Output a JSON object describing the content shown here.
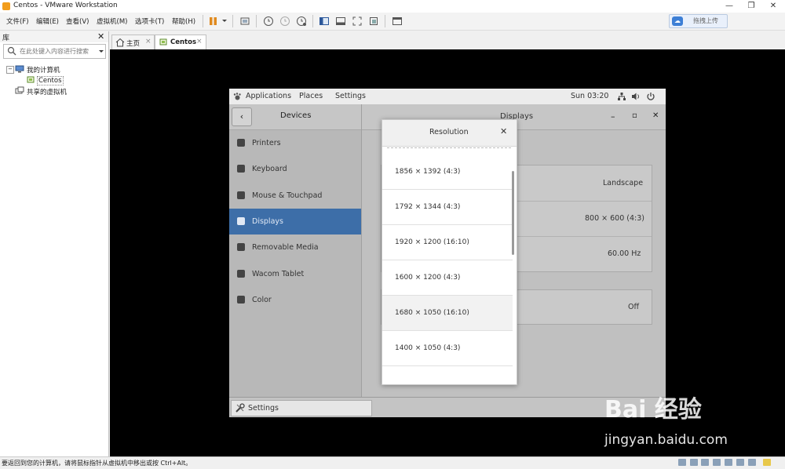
{
  "window": {
    "title": "Centos - VMware Workstation",
    "minimize": "—",
    "restore": "❐",
    "close": "✕"
  },
  "menubar": {
    "items": [
      "文件(F)",
      "编辑(E)",
      "查看(V)",
      "虚拟机(M)",
      "选项卡(T)",
      "帮助(H)"
    ],
    "cloud_button": "拖拽上传"
  },
  "library": {
    "title": "库",
    "close": "✕",
    "search_placeholder": "在此处键入内容进行搜索",
    "tree": {
      "root": "我的计算机",
      "vm": "Centos",
      "shared": "共享的虚拟机"
    }
  },
  "tabs": [
    {
      "label": "主页",
      "close": "×"
    },
    {
      "label": "Centos",
      "close": "×"
    }
  ],
  "gnome": {
    "applications": "Applications",
    "places": "Places",
    "settings": "Settings",
    "clock": "Sun 03:20"
  },
  "settings_window": {
    "sidebar_title": "Devices",
    "back": "‹",
    "title": "Displays",
    "min": "–",
    "max": "▫",
    "close": "✕",
    "items": [
      "Printers",
      "Keyboard",
      "Mouse & Touchpad",
      "Displays",
      "Removable Media",
      "Wacom Tablet",
      "Color"
    ],
    "active_item": "Displays",
    "orientation": "Landscape",
    "resolution": "800 × 600 (4:3)",
    "refresh_rate": "60.00 Hz",
    "toggle": "Off",
    "taskbar_item": "Settings"
  },
  "resolution_dialog": {
    "title": "Resolution",
    "close": "✕",
    "options": [
      "1856 × 1392 (4:3)",
      "1792 × 1344 (4:3)",
      "1920 × 1200 (16:10)",
      "1600 × 1200 (4:3)",
      "1680 × 1050 (16:10)",
      "1400 × 1050 (4:3)"
    ],
    "highlighted": "1680 × 1050 (16:10)"
  },
  "statusbar": {
    "hint": "要返回到您的计算机，请将鼠标指针从虚拟机中移出或按 Ctrl+Alt。"
  },
  "watermark": {
    "logo": "Bai 经验",
    "url": "jingyan.baidu.com"
  }
}
